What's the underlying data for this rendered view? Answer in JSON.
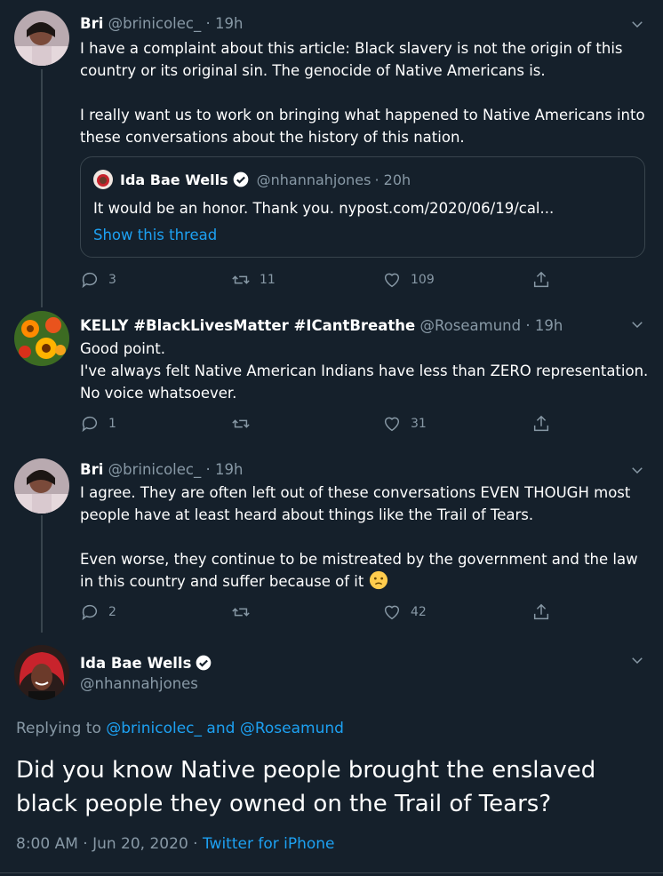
{
  "tweets": [
    {
      "name": "Bri",
      "handle": "@brinicolec_",
      "time": "· 19h",
      "text": "I have a complaint about this article: Black slavery is not the origin of this country or its original sin. The genocide of Native Americans is.\n\nI really want us to work on bringing what happened to Native Americans into these conversations about the history of this nation.",
      "quote": {
        "name": "Ida Bae Wells",
        "handle": "@nhannahjones",
        "time": "· 20h",
        "text": "It would be an honor. Thank you. nypost.com/2020/06/19/cal...",
        "link": "Show this thread"
      },
      "replies": "3",
      "retweets": "11",
      "likes": "109"
    },
    {
      "name": "KELLY #BlackLivesMatter #ICantBreathe",
      "handle": "@Roseamund",
      "time": "· 19h",
      "text": "Good point.\nI've always felt Native American Indians have less than ZERO representation. No voice whatsoever.",
      "replies": "1",
      "retweets": "",
      "likes": "31"
    },
    {
      "name": "Bri",
      "handle": "@brinicolec_",
      "time": "· 19h",
      "text": "I agree. They are often left out of these conversations EVEN THOUGH most people have at least heard about things like the Trail of Tears.\n\nEven worse, they continue to be mistreated by the government and the law in this country and suffer because of it ",
      "replies": "2",
      "retweets": "",
      "likes": "42"
    }
  ],
  "main_tweet": {
    "name": "Ida Bae Wells",
    "handle": "@nhannahjones",
    "replying_prefix": "Replying to ",
    "reply_to_1": "@brinicolec_",
    "reply_and": " and ",
    "reply_to_2": "@Roseamund",
    "text": "Did you know Native people brought the enslaved black people they owned on the Trail of Tears?",
    "time": "8:00 AM · Jun 20, 2020 · ",
    "source": "Twitter for iPhone"
  },
  "colors": {
    "background": "#15202b",
    "accent": "#1da1f2",
    "muted": "#8899a6",
    "border": "#38444d"
  }
}
